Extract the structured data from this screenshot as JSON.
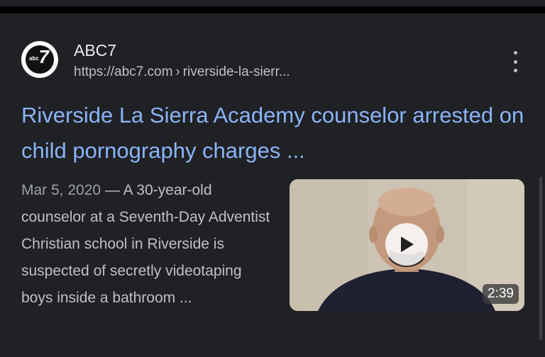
{
  "result": {
    "site_name": "ABC7",
    "url_domain": "https://abc7.com",
    "url_separator": "›",
    "url_path": "riverside-la-sierr...",
    "favicon": {
      "icon": "abc7-logo-icon",
      "logo_text_small": "abc",
      "logo_text_large": "7"
    },
    "more_icon": "more-vert-icon",
    "title": "Riverside La Sierra Academy counselor arrested on child pornography charges ...",
    "date": "Mar 5, 2020",
    "date_separator": "—",
    "snippet": "A 30-year-old counselor at a Seventh-Day Adventist Christian school in Riverside is suspected of secretly videotaping boys inside a bathroom ...",
    "video": {
      "duration": "2:39",
      "play_icon": "play-icon"
    }
  },
  "colors": {
    "background": "#000000",
    "card": "#202124",
    "title_link": "#8ab4f8",
    "text_primary": "#e8eaed",
    "text_secondary": "#bdc1c6"
  }
}
